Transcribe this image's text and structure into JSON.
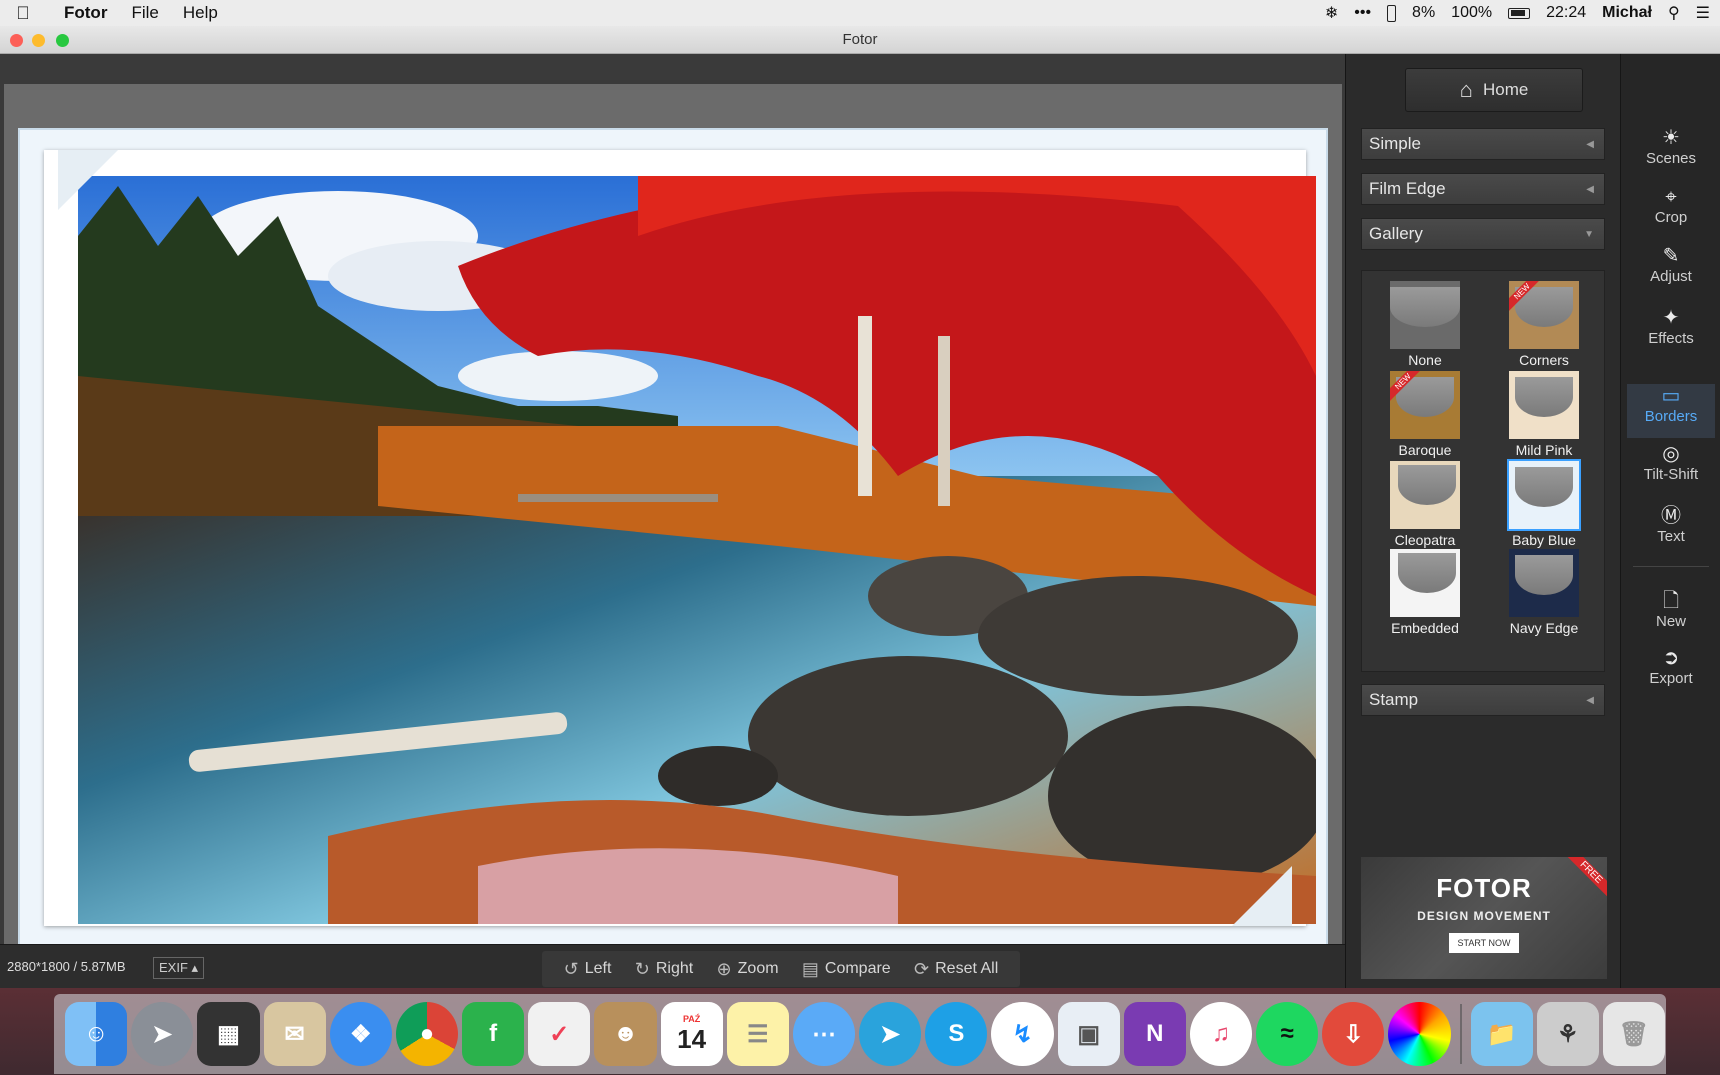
{
  "menubar": {
    "app_name": "Fotor",
    "items": [
      "File",
      "Help"
    ],
    "status": {
      "percent_small": "8%",
      "battery": "100%",
      "time": "22:24",
      "user": "Michał"
    }
  },
  "window": {
    "title": "Fotor"
  },
  "canvas": {
    "image_info": "2880*1800 / 5.87MB",
    "exif_label": "EXIF ▴"
  },
  "toolbar": {
    "left": "Left",
    "right": "Right",
    "zoom": "Zoom",
    "compare": "Compare",
    "reset_all": "Reset All"
  },
  "panel": {
    "home_label": "Home",
    "sections": {
      "simple": "Simple",
      "film_edge": "Film Edge",
      "gallery": "Gallery",
      "stamp": "Stamp"
    },
    "gallery_items": [
      {
        "label": "None",
        "badge": ""
      },
      {
        "label": "Corners",
        "badge": "NEW"
      },
      {
        "label": "Baroque",
        "badge": "NEW"
      },
      {
        "label": "Mild Pink",
        "badge": ""
      },
      {
        "label": "Cleopatra",
        "badge": ""
      },
      {
        "label": "Baby Blue",
        "badge": ""
      },
      {
        "label": "Embedded",
        "badge": ""
      },
      {
        "label": "Navy Edge",
        "badge": ""
      }
    ],
    "selected_gallery_item": "Baby Blue",
    "ad": {
      "title": "FOTOR",
      "subtitle": "DESIGN MOVEMENT",
      "cta": "START NOW",
      "badge": "FREE"
    }
  },
  "iconbar": {
    "items": [
      {
        "label": "Scenes",
        "icon": "sun-icon"
      },
      {
        "label": "Crop",
        "icon": "crop-icon"
      },
      {
        "label": "Adjust",
        "icon": "pencil-icon"
      },
      {
        "label": "Effects",
        "icon": "sparkle-icon"
      },
      {
        "label": "Borders",
        "icon": "border-icon"
      },
      {
        "label": "Tilt-Shift",
        "icon": "target-icon"
      },
      {
        "label": "Text",
        "icon": "text-icon"
      },
      {
        "label": "New",
        "icon": "new-file-icon"
      },
      {
        "label": "Export",
        "icon": "export-icon"
      }
    ],
    "active": "Borders"
  },
  "dock": {
    "calendar_month": "PAŹ",
    "calendar_day": "14",
    "apps": [
      "finder-icon",
      "launchpad-icon",
      "photo-slideshow-icon",
      "mail-icon",
      "safari-icon",
      "chrome-icon",
      "feedly-icon",
      "pocket-icon",
      "contacts-icon",
      "calendar-icon",
      "notes-icon",
      "messages-icon",
      "telegram-icon",
      "skype-icon",
      "messenger-icon",
      "preview-icon",
      "onenote-icon",
      "itunes-icon",
      "spotify-icon",
      "downloader-icon",
      "color-picker-icon",
      "downloads-folder-icon",
      "documents-stack-icon",
      "trash-icon"
    ]
  },
  "colors": {
    "accent": "#57aaf6",
    "selected_border": "#3aa0ff",
    "badge_red": "#d6282a"
  }
}
